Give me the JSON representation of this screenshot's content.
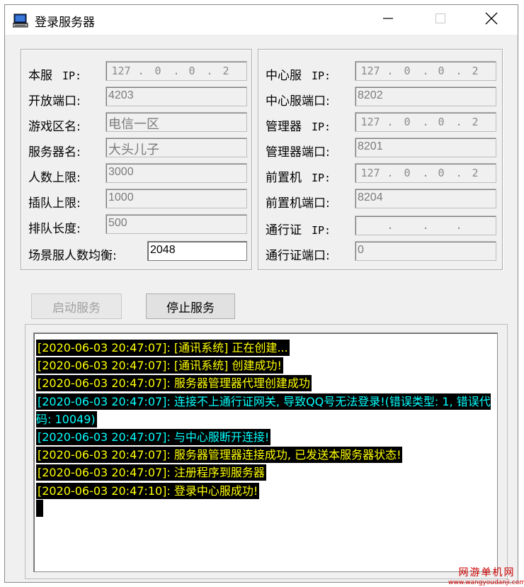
{
  "window": {
    "title": "登录服务器",
    "minimize_glyph": "—",
    "maximize_glyph": "□",
    "close_glyph": "✕"
  },
  "local_server": {
    "ip_label": "本服",
    "ip_suffix": "IP:",
    "ip": [
      "127",
      "0",
      "0",
      "2"
    ],
    "open_port_label": "开放端口:",
    "open_port": "4203",
    "zone_name_label": "游戏区名:",
    "zone_name": "电信一区",
    "server_name_label": "服务器名:",
    "server_name": "大头儿子",
    "max_players_label": "人数上限:",
    "max_players": "3000",
    "max_queue_jump_label": "插队上限:",
    "max_queue_jump": "1000",
    "queue_length_label": "排队长度:",
    "queue_length": "500",
    "scene_balance_label": "场景服人数均衡:",
    "scene_balance": "2048"
  },
  "remote_servers": {
    "center_label": "中心服",
    "center_ip_suffix": "IP:",
    "center_ip": [
      "127",
      "0",
      "0",
      "2"
    ],
    "center_port_label": "中心服端口:",
    "center_port": "8202",
    "manager_label": "管理器",
    "manager_ip_suffix": "IP:",
    "manager_ip": [
      "127",
      "0",
      "0",
      "2"
    ],
    "manager_port_label": "管理器端口:",
    "manager_port": "8201",
    "frontend_label": "前置机",
    "frontend_ip_suffix": "IP:",
    "frontend_ip": [
      "127",
      "0",
      "0",
      "2"
    ],
    "frontend_port_label": "前置机端口:",
    "frontend_port": "8204",
    "pass_label": "通行证",
    "pass_ip_suffix": "IP:",
    "pass_ip": [
      "",
      "",
      "",
      ""
    ],
    "pass_port_label": "通行证端口:",
    "pass_port": "0"
  },
  "buttons": {
    "start": "启动服务",
    "stop": "停止服务"
  },
  "log": [
    {
      "text": "[2020-06-03 20:47:07]: [通讯系统] 正在创建...",
      "color": "#ffff00"
    },
    {
      "text": "[2020-06-03 20:47:07]: [通讯系统] 创建成功!",
      "color": "#ffff00"
    },
    {
      "text": "[2020-06-03 20:47:07]: 服务器管理器代理创建成功",
      "color": "#ffff00"
    },
    {
      "text": "[2020-06-03 20:47:07]: 连接不上通行证网关, 导致QQ号无法登录!(错误类型: 1, 错误代码: 10049)",
      "color": "#00ffff"
    },
    {
      "text": "[2020-06-03 20:47:07]: 与中心服断开连接!",
      "color": "#00ffff"
    },
    {
      "text": "[2020-06-03 20:47:07]: 服务器管理器连接成功, 已发送本服务器状态!",
      "color": "#ffff00"
    },
    {
      "text": "[2020-06-03 20:47:07]: 注册程序到服务器",
      "color": "#ffff00"
    },
    {
      "text": "[2020-06-03 20:47:10]: 登录中心服成功!",
      "color": "#ffff00"
    }
  ],
  "watermark": {
    "line1": "网游单机网",
    "line2": "www.wangyoudanji.com"
  }
}
